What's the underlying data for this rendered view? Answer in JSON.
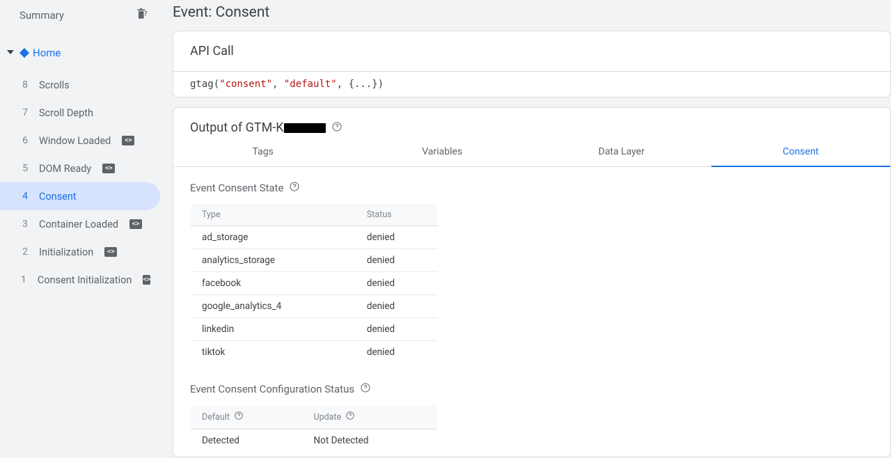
{
  "sidebar": {
    "summary_label": "Summary",
    "home_label": "Home",
    "events": [
      {
        "n": "8",
        "label": "Scrolls",
        "badge": false
      },
      {
        "n": "7",
        "label": "Scroll Depth",
        "badge": false
      },
      {
        "n": "6",
        "label": "Window Loaded",
        "badge": true
      },
      {
        "n": "5",
        "label": "DOM Ready",
        "badge": true
      },
      {
        "n": "4",
        "label": "Consent",
        "badge": false,
        "active": true
      },
      {
        "n": "3",
        "label": "Container Loaded",
        "badge": true
      },
      {
        "n": "2",
        "label": "Initialization",
        "badge": true
      },
      {
        "n": "1",
        "label": "Consent Initialization",
        "badge": true
      }
    ]
  },
  "main": {
    "title": "Event: Consent",
    "api_card": {
      "title": "API Call",
      "code_prefix": "gtag(",
      "code_str1": "\"consent\"",
      "code_sep1": ", ",
      "code_str2": "\"default\"",
      "code_suffix": ", {...})"
    },
    "output_card": {
      "title_prefix": "Output of GTM-K",
      "tabs": [
        "Tags",
        "Variables",
        "Data Layer",
        "Consent"
      ],
      "active_tab_index": 3,
      "consent_state": {
        "title": "Event Consent State",
        "cols": [
          "Type",
          "Status"
        ],
        "rows": [
          [
            "ad_storage",
            "denied"
          ],
          [
            "analytics_storage",
            "denied"
          ],
          [
            "facebook",
            "denied"
          ],
          [
            "google_analytics_4",
            "denied"
          ],
          [
            "linkedin",
            "denied"
          ],
          [
            "tiktok",
            "denied"
          ]
        ]
      },
      "config_status": {
        "title": "Event Consent Configuration Status",
        "cols": [
          "Default",
          "Update"
        ],
        "rows": [
          [
            "Detected",
            "Not Detected"
          ]
        ]
      }
    }
  }
}
